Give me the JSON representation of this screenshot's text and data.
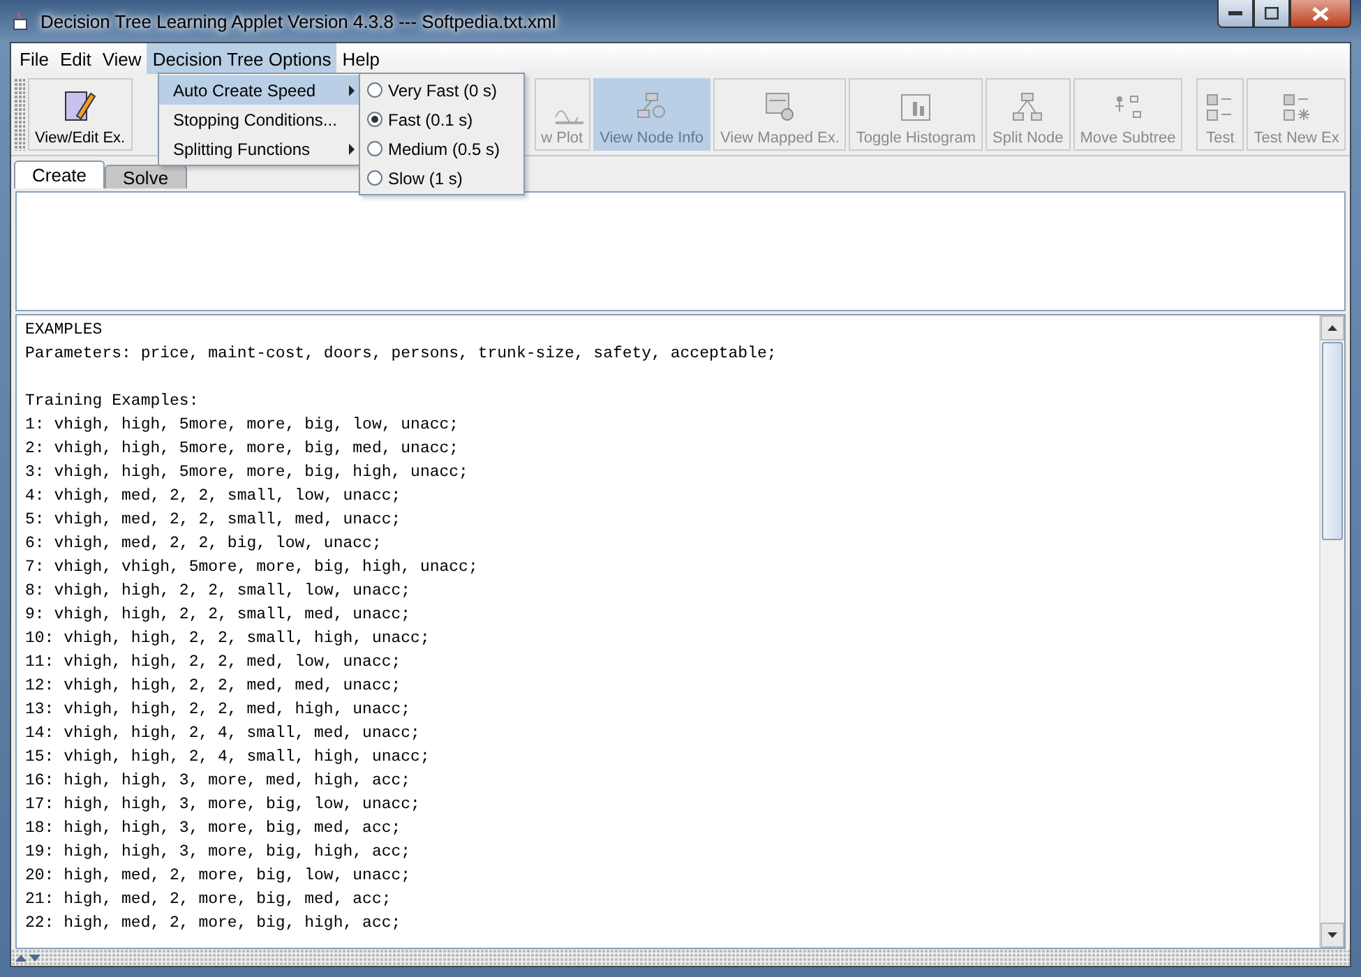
{
  "window": {
    "title": "Decision Tree Learning Applet Version 4.3.8 --- Softpedia.txt.xml"
  },
  "menu_bar": [
    {
      "label": "File",
      "selected": false
    },
    {
      "label": "Edit",
      "selected": false
    },
    {
      "label": "View",
      "selected": false
    },
    {
      "label": "Decision Tree Options",
      "selected": true
    },
    {
      "label": "Help",
      "selected": false
    }
  ],
  "open_menu": {
    "items": [
      {
        "label": "Auto Create Speed",
        "selected": true,
        "submenu": true
      },
      {
        "label": "Stopping Conditions...",
        "selected": false,
        "submenu": false
      },
      {
        "label": "Splitting Functions",
        "selected": false,
        "submenu": true
      }
    ],
    "submenu": [
      {
        "label": "Very Fast (0 s)",
        "selected": false
      },
      {
        "label": "Fast (0.1 s)",
        "selected": true
      },
      {
        "label": "Medium (0.5 s)",
        "selected": false
      },
      {
        "label": "Slow (1 s)",
        "selected": false
      }
    ]
  },
  "toolbar": [
    {
      "label": "View/Edit Ex.",
      "kind": "edit",
      "disabled": false,
      "highlighted": false
    },
    {
      "label": "w Plot",
      "kind": "plot",
      "disabled": true,
      "highlighted": false
    },
    {
      "label": "View Node Info",
      "kind": "node",
      "disabled": true,
      "highlighted": true
    },
    {
      "label": "View Mapped Ex.",
      "kind": "mapped",
      "disabled": true,
      "highlighted": false
    },
    {
      "label": "Toggle Histogram",
      "kind": "histogram",
      "disabled": true,
      "highlighted": false
    },
    {
      "label": "Split Node",
      "kind": "split",
      "disabled": true,
      "highlighted": false
    },
    {
      "label": "Move Subtree",
      "kind": "move",
      "disabled": true,
      "highlighted": false
    },
    {
      "label": "Test",
      "kind": "test",
      "disabled": true,
      "highlighted": false
    },
    {
      "label": "Test New Ex",
      "kind": "testnew",
      "disabled": true,
      "highlighted": false
    }
  ],
  "tabs": [
    {
      "label": "Create",
      "selected": true
    },
    {
      "label": "Solve",
      "selected": false
    }
  ],
  "text_area": {
    "header": [
      "EXAMPLES",
      "Parameters: price, maint-cost, doors, persons, trunk-size, safety, acceptable;"
    ],
    "section_title": "Training Examples:",
    "lines": [
      "1: vhigh, high, 5more, more, big, low, unacc;",
      "2: vhigh, high, 5more, more, big, med, unacc;",
      "3: vhigh, high, 5more, more, big, high, unacc;",
      "4: vhigh, med, 2, 2, small, low, unacc;",
      "5: vhigh, med, 2, 2, small, med, unacc;",
      "6: vhigh, med, 2, 2, big, low, unacc;",
      "7: vhigh, vhigh, 5more, more, big, high, unacc;",
      "8: vhigh, high, 2, 2, small, low, unacc;",
      "9: vhigh, high, 2, 2, small, med, unacc;",
      "10: vhigh, high, 2, 2, small, high, unacc;",
      "11: vhigh, high, 2, 2, med, low, unacc;",
      "12: vhigh, high, 2, 2, med, med, unacc;",
      "13: vhigh, high, 2, 2, med, high, unacc;",
      "14: vhigh, high, 2, 4, small, med, unacc;",
      "15: vhigh, high, 2, 4, small, high, unacc;",
      "16: high, high, 3, more, med, high, acc;",
      "17: high, high, 3, more, big, low, unacc;",
      "18: high, high, 3, more, big, med, acc;",
      "19: high, high, 3, more, big, high, acc;",
      "20: high, med, 2, more, big, low, unacc;",
      "21: high, med, 2, more, big, med, acc;",
      "22: high, med, 2, more, big, high, acc;"
    ]
  }
}
